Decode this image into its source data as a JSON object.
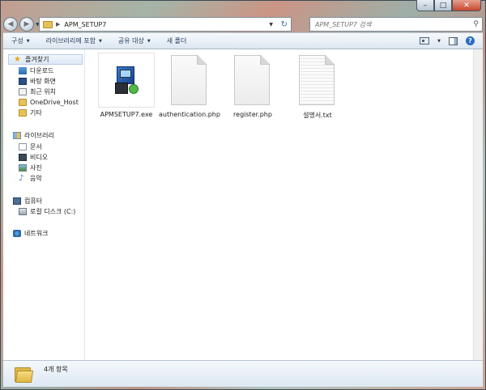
{
  "window": {
    "controls": {
      "minimize": "–",
      "maximize": "□",
      "close": "✕"
    }
  },
  "navbar": {
    "back_icon": "arrow-left-icon",
    "forward_icon": "arrow-right-icon",
    "path": "APM_SETUP7",
    "search_placeholder": "APM_SETUP7 검색"
  },
  "toolbar": {
    "organize": "구성",
    "include_in_library": "라이브러리에 포함",
    "share_with": "공유 대상",
    "new_folder": "새 폴더"
  },
  "sidebar": {
    "favorites": "즐겨찾기",
    "favorites_items": [
      "다운로드",
      "바탕 화면",
      "최근 위치",
      "OneDrive_Host",
      "기타"
    ],
    "libraries": "라이브러리",
    "library_items": [
      "문서",
      "비디오",
      "사진",
      "음악"
    ],
    "computer": "컴퓨터",
    "computer_items": [
      "로컬 디스크 (C:)"
    ],
    "network": "네트워크"
  },
  "files": [
    {
      "name": "APMSETUP7.exe",
      "icon": "installer-icon"
    },
    {
      "name": "authentication.php",
      "icon": "blank-document-icon"
    },
    {
      "name": "register.php",
      "icon": "blank-document-icon"
    },
    {
      "name": "설명서.txt",
      "icon": "text-document-icon"
    }
  ],
  "details": {
    "item_count": "4개 항목"
  }
}
